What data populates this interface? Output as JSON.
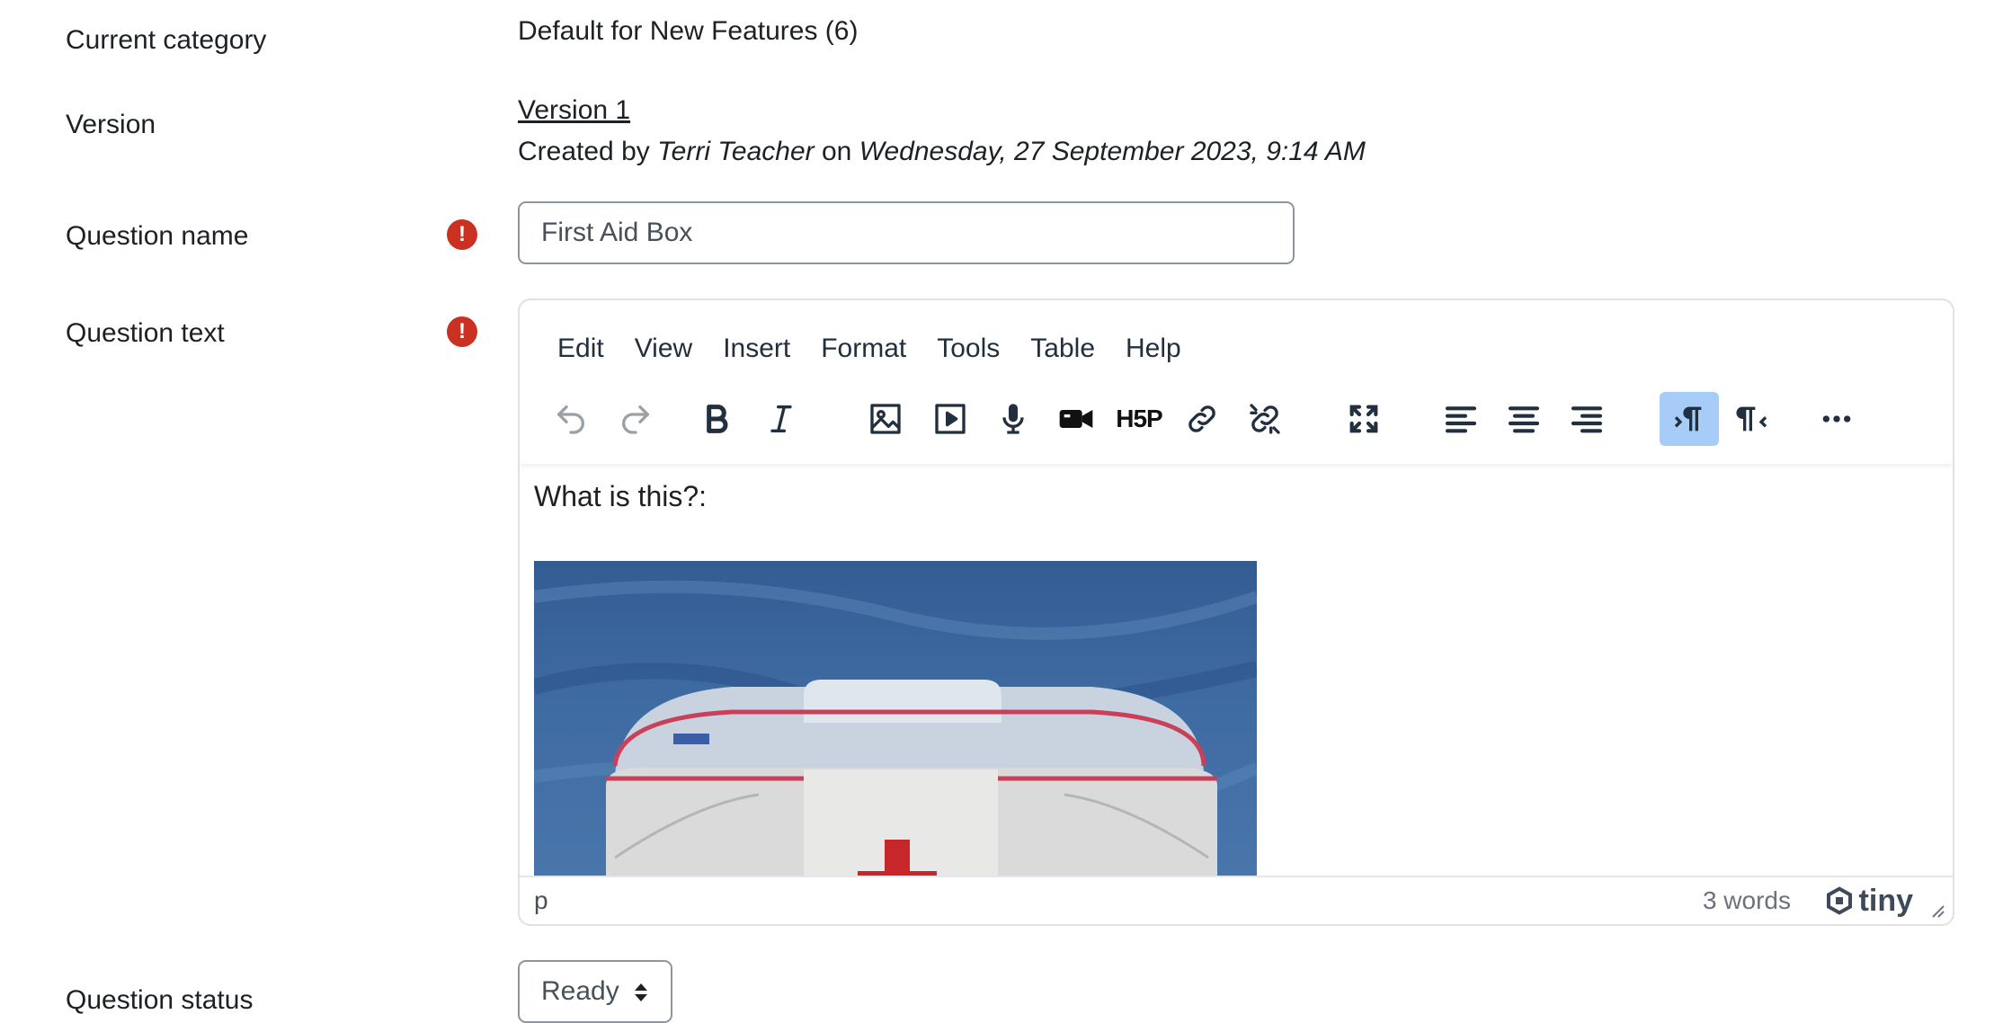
{
  "labels": {
    "current_category": "Current category",
    "version": "Version",
    "question_name": "Question name",
    "question_text": "Question text",
    "question_status": "Question status"
  },
  "category_value": "Default for New Features (6)",
  "version_link": "Version 1",
  "created": {
    "prefix": "Created by",
    "author": "Terri Teacher",
    "on": "on",
    "date": "Wednesday, 27 September 2023, 9:14 AM"
  },
  "question_name_value": "First Aid Box",
  "editor": {
    "menu": [
      "Edit",
      "View",
      "Insert",
      "Format",
      "Tools",
      "Table",
      "Help"
    ],
    "toolbar": [
      "undo-icon",
      "redo-icon",
      "bold-icon",
      "italic-icon",
      "image-icon",
      "media-icon",
      "record-audio-icon",
      "record-video-icon",
      "h5p-icon",
      "link-icon",
      "unlink-icon",
      "fullscreen-icon",
      "align-left-icon",
      "align-center-icon",
      "align-right-icon",
      "ltr-icon",
      "rtl-icon",
      "more-icon"
    ],
    "h5p_label": "H5P",
    "content_text": "What is this?:",
    "status_path": "p",
    "word_count": "3 words",
    "brand": "tiny"
  },
  "question_status_value": "Ready",
  "colors": {
    "required": "#ca3120",
    "active_button": "#a6ccf7",
    "text": "#1d2125"
  }
}
